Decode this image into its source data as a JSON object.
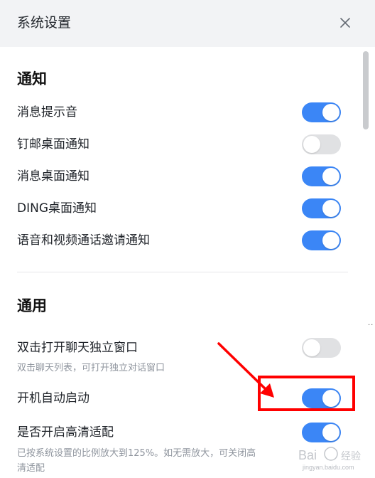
{
  "header": {
    "title": "系统设置",
    "close_icon": "close-icon"
  },
  "sections": {
    "notifications": {
      "title": "通知",
      "items": [
        {
          "label": "消息提示音",
          "enabled": true
        },
        {
          "label": "钉邮桌面通知",
          "enabled": false
        },
        {
          "label": "消息桌面通知",
          "enabled": true
        },
        {
          "label": "DING桌面通知",
          "enabled": true
        },
        {
          "label": "语音和视频通话邀请通知",
          "enabled": true
        }
      ]
    },
    "general": {
      "title": "通用",
      "items": [
        {
          "label": "双击打开聊天独立窗口",
          "hint": "双击聊天列表，可打开独立对话窗口",
          "enabled": false
        },
        {
          "label": "开机自动启动",
          "enabled": true
        },
        {
          "label": "是否开启高清适配",
          "hint": "已按系统设置的比例放大到125%。如无需放大，可关闭高",
          "hint2": "清适配",
          "enabled": true
        }
      ]
    }
  },
  "colors": {
    "toggle_on": "#3b86f6",
    "toggle_off": "#e0e1e3",
    "header_bg": "#f2f3f5",
    "annotation_red": "#ff0000"
  },
  "annotation": {
    "type": "red-box-and-arrow",
    "target": "开机自动启动"
  }
}
